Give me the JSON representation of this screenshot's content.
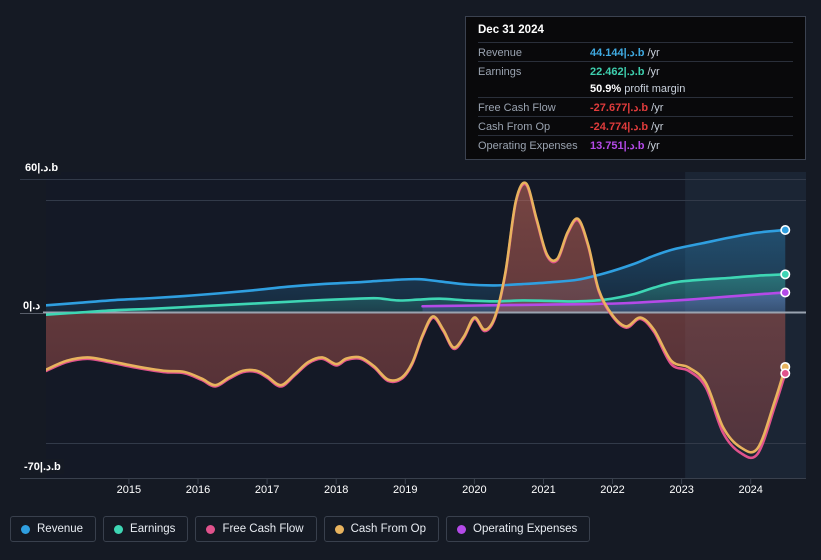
{
  "currency_suffix": "|.د.b",
  "tooltip": {
    "date": "Dec 31 2024",
    "rows": [
      {
        "label": "Revenue",
        "value": "44.144|.د.b",
        "unit": "/yr",
        "color": "blue"
      },
      {
        "label": "Earnings",
        "value": "22.462|.د.b",
        "unit": "/yr",
        "color": "teal"
      },
      {
        "label": "",
        "value": "50.9%",
        "unit": "profit margin",
        "color": "white"
      },
      {
        "label": "Free Cash Flow",
        "value": "-27.677|.د.b",
        "unit": "/yr",
        "color": "red"
      },
      {
        "label": "Cash From Op",
        "value": "-24.774|.د.b",
        "unit": "/yr",
        "color": "red"
      },
      {
        "label": "Operating Expenses",
        "value": "13.751|.د.b",
        "unit": "/yr",
        "color": "purple"
      }
    ]
  },
  "legend": {
    "items": [
      {
        "label": "Revenue",
        "color": "#2f9fe0"
      },
      {
        "label": "Earnings",
        "color": "#3ed6b4"
      },
      {
        "label": "Free Cash Flow",
        "color": "#e0528c"
      },
      {
        "label": "Cash From Op",
        "color": "#e8b35e"
      },
      {
        "label": "Operating Expenses",
        "color": "#b44ae8"
      }
    ]
  },
  "chart_data": {
    "type": "line",
    "title": "",
    "xlabel": "",
    "ylabel": "",
    "grid": true,
    "legend_position": "bottom",
    "ylim": [
      -70,
      60
    ],
    "y_ticks": [
      {
        "value": 60,
        "label": "60|.د.b"
      },
      {
        "value": 0,
        "label": "0|.د"
      },
      {
        "value": -70,
        "label": "-70|.د.b"
      }
    ],
    "x_ticks": [
      "2015",
      "2016",
      "2017",
      "2018",
      "2019",
      "2020",
      "2021",
      "2022",
      "2023",
      "2024"
    ],
    "x_range": [
      2014.3,
      2025.3
    ],
    "highlight_band": {
      "from": 2023.55,
      "to": 2025.3
    },
    "series": [
      {
        "name": "Revenue",
        "color": "#2f9fe0",
        "fill": true,
        "x": [
          2014.3,
          2014.8,
          2015.3,
          2015.8,
          2016.3,
          2016.8,
          2017.3,
          2017.8,
          2018.3,
          2018.8,
          2019.1,
          2019.4,
          2019.7,
          2020.0,
          2020.4,
          2020.8,
          2021.2,
          2021.6,
          2022.0,
          2022.4,
          2022.8,
          2023.1,
          2023.4,
          2023.8,
          2024.2,
          2024.6,
          2025.0
        ],
        "y": [
          3.0,
          4.2,
          5.4,
          6.2,
          7.2,
          8.4,
          9.8,
          11.4,
          12.6,
          13.4,
          14.0,
          14.6,
          14.8,
          13.8,
          12.4,
          12.0,
          12.6,
          13.4,
          14.6,
          17.6,
          21.6,
          25.4,
          28.4,
          31.0,
          33.6,
          35.8,
          37.0
        ]
      },
      {
        "name": "Earnings",
        "color": "#3ed6b4",
        "fill": true,
        "x": [
          2014.3,
          2014.8,
          2015.3,
          2015.8,
          2016.3,
          2016.8,
          2017.3,
          2017.8,
          2018.3,
          2018.8,
          2019.1,
          2019.4,
          2019.7,
          2020.0,
          2020.4,
          2020.8,
          2021.2,
          2021.6,
          2022.0,
          2022.4,
          2022.8,
          2023.1,
          2023.4,
          2023.8,
          2024.2,
          2024.6,
          2025.0
        ],
        "y": [
          -1.2,
          -0.2,
          0.8,
          1.4,
          2.2,
          3.0,
          3.8,
          4.6,
          5.4,
          6.0,
          6.2,
          5.2,
          5.6,
          6.0,
          5.2,
          4.8,
          5.2,
          5.0,
          4.8,
          5.6,
          8.0,
          11.0,
          13.4,
          14.6,
          15.4,
          16.4,
          17.0
        ]
      },
      {
        "name": "Operating Expenses",
        "color": "#b44ae8",
        "fill": true,
        "start_x": 2019.75,
        "x": [
          2019.75,
          2020.2,
          2020.7,
          2021.2,
          2021.7,
          2022.2,
          2022.7,
          2023.2,
          2023.7,
          2024.2,
          2024.7,
          2025.0
        ],
        "y": [
          2.6,
          2.8,
          3.0,
          3.2,
          3.4,
          3.6,
          4.0,
          4.8,
          5.8,
          7.0,
          8.2,
          8.8
        ]
      },
      {
        "name": "Cash From Op",
        "color": "#e8b35e",
        "fill": true,
        "x": [
          2014.3,
          2014.6,
          2014.9,
          2015.2,
          2015.6,
          2016.0,
          2016.3,
          2016.55,
          2016.75,
          2016.95,
          2017.15,
          2017.35,
          2017.5,
          2017.7,
          2017.9,
          2018.1,
          2018.3,
          2018.5,
          2018.65,
          2018.85,
          2019.05,
          2019.25,
          2019.45,
          2019.6,
          2019.75,
          2019.9,
          2020.05,
          2020.2,
          2020.35,
          2020.5,
          2020.65,
          2020.8,
          2020.95,
          2021.1,
          2021.25,
          2021.4,
          2021.55,
          2021.7,
          2021.85,
          2022.0,
          2022.15,
          2022.3,
          2022.5,
          2022.7,
          2022.9,
          2023.1,
          2023.35,
          2023.6,
          2023.85,
          2024.1,
          2024.35,
          2024.6,
          2024.85,
          2025.0
        ],
        "y": [
          -26.0,
          -22.0,
          -20.5,
          -22.0,
          -24.5,
          -26.5,
          -27.0,
          -30.0,
          -33.0,
          -29.5,
          -26.5,
          -26.5,
          -29.0,
          -33.0,
          -28.0,
          -22.5,
          -20.5,
          -23.5,
          -21.0,
          -20.5,
          -24.5,
          -30.5,
          -29.5,
          -23.0,
          -10.5,
          -2.0,
          -8.0,
          -16.0,
          -11.0,
          -2.5,
          -8.0,
          -2.0,
          18.0,
          50.0,
          58.0,
          42.0,
          26.0,
          24.0,
          36.0,
          42.0,
          30.0,
          10.0,
          -1.5,
          -6.5,
          -2.5,
          -8.0,
          -22.0,
          -25.0,
          -32.0,
          -52.0,
          -61.0,
          -61.5,
          -40.0,
          -24.8
        ]
      },
      {
        "name": "Free Cash Flow",
        "color": "#e0528c",
        "fill": false,
        "x": [
          2014.3,
          2014.6,
          2014.9,
          2015.2,
          2015.6,
          2016.0,
          2016.3,
          2016.55,
          2016.75,
          2016.95,
          2017.15,
          2017.35,
          2017.5,
          2017.7,
          2017.9,
          2018.1,
          2018.3,
          2018.5,
          2018.65,
          2018.85,
          2019.05,
          2019.25,
          2019.45,
          2019.6,
          2019.75,
          2019.9,
          2020.05,
          2020.2,
          2020.35,
          2020.5,
          2020.65,
          2020.8,
          2020.95,
          2021.1,
          2021.25,
          2021.4,
          2021.55,
          2021.7,
          2021.85,
          2022.0,
          2022.15,
          2022.3,
          2022.5,
          2022.7,
          2022.9,
          2023.1,
          2023.35,
          2023.6,
          2023.85,
          2024.1,
          2024.35,
          2024.6,
          2024.85,
          2025.0
        ],
        "y": [
          -26.6,
          -22.6,
          -21.1,
          -22.6,
          -25.1,
          -27.1,
          -27.6,
          -30.6,
          -33.6,
          -30.1,
          -27.1,
          -27.1,
          -29.6,
          -33.6,
          -28.6,
          -23.1,
          -21.1,
          -24.1,
          -21.6,
          -21.1,
          -25.1,
          -31.1,
          -30.1,
          -23.6,
          -11.1,
          -2.6,
          -8.6,
          -16.6,
          -11.6,
          -3.1,
          -8.6,
          -2.6,
          17.4,
          49.4,
          57.4,
          41.4,
          25.4,
          23.4,
          35.4,
          41.4,
          29.4,
          9.4,
          -2.1,
          -7.1,
          -3.1,
          -9.0,
          -23.5,
          -26.5,
          -34.0,
          -54.5,
          -63.5,
          -64.0,
          -42.5,
          -27.7
        ]
      }
    ]
  }
}
